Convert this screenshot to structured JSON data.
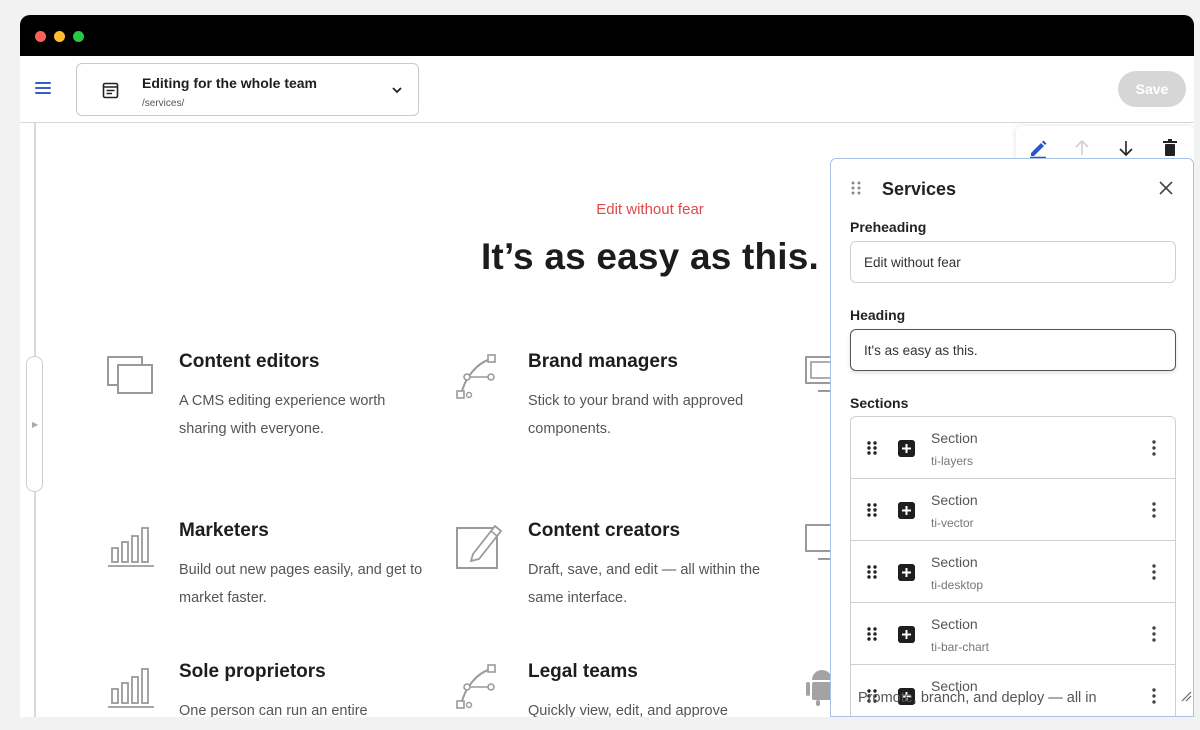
{
  "header": {
    "page_title": "Editing for the whole team",
    "page_path": "/services/",
    "save_label": "Save"
  },
  "content": {
    "preheading": "Edit without fear",
    "heading": "It’s as easy as this.",
    "cards": [
      {
        "title": "Content editors",
        "desc": "A CMS editing experience worth sharing with everyone.",
        "icon": "layers-icon"
      },
      {
        "title": "Brand managers",
        "desc": "Stick to your brand with approved components.",
        "icon": "vector-icon"
      },
      {
        "title": "Marketers",
        "desc": "Build out new pages easily, and get to market faster.",
        "icon": "bar-chart-icon"
      },
      {
        "title": "Content creators",
        "desc": "Draft, save, and edit — all within the same interface.",
        "icon": "edit-icon"
      },
      {
        "title": "Sole proprietors",
        "desc": "One person can run an entire",
        "icon": "bar-chart-icon"
      },
      {
        "title": "Legal teams",
        "desc": "Quickly view, edit, and approve",
        "icon": "vector-icon"
      }
    ],
    "partial_text": "Promote, branch, and deploy — all in"
  },
  "panel": {
    "title": "Services",
    "preheading_label": "Preheading",
    "preheading_value": "Edit without fear",
    "heading_label": "Heading",
    "heading_value": "It's as easy as this.",
    "sections_label": "Sections",
    "sections": [
      {
        "label": "Section",
        "sub": "ti-layers"
      },
      {
        "label": "Section",
        "sub": "ti-vector"
      },
      {
        "label": "Section",
        "sub": "ti-desktop"
      },
      {
        "label": "Section",
        "sub": "ti-bar-chart"
      },
      {
        "label": "Section",
        "sub": ""
      }
    ]
  },
  "colors": {
    "accent_blue": "#3b5fc0",
    "preheading_red": "#e04848",
    "panel_border": "#a9c3e6"
  }
}
